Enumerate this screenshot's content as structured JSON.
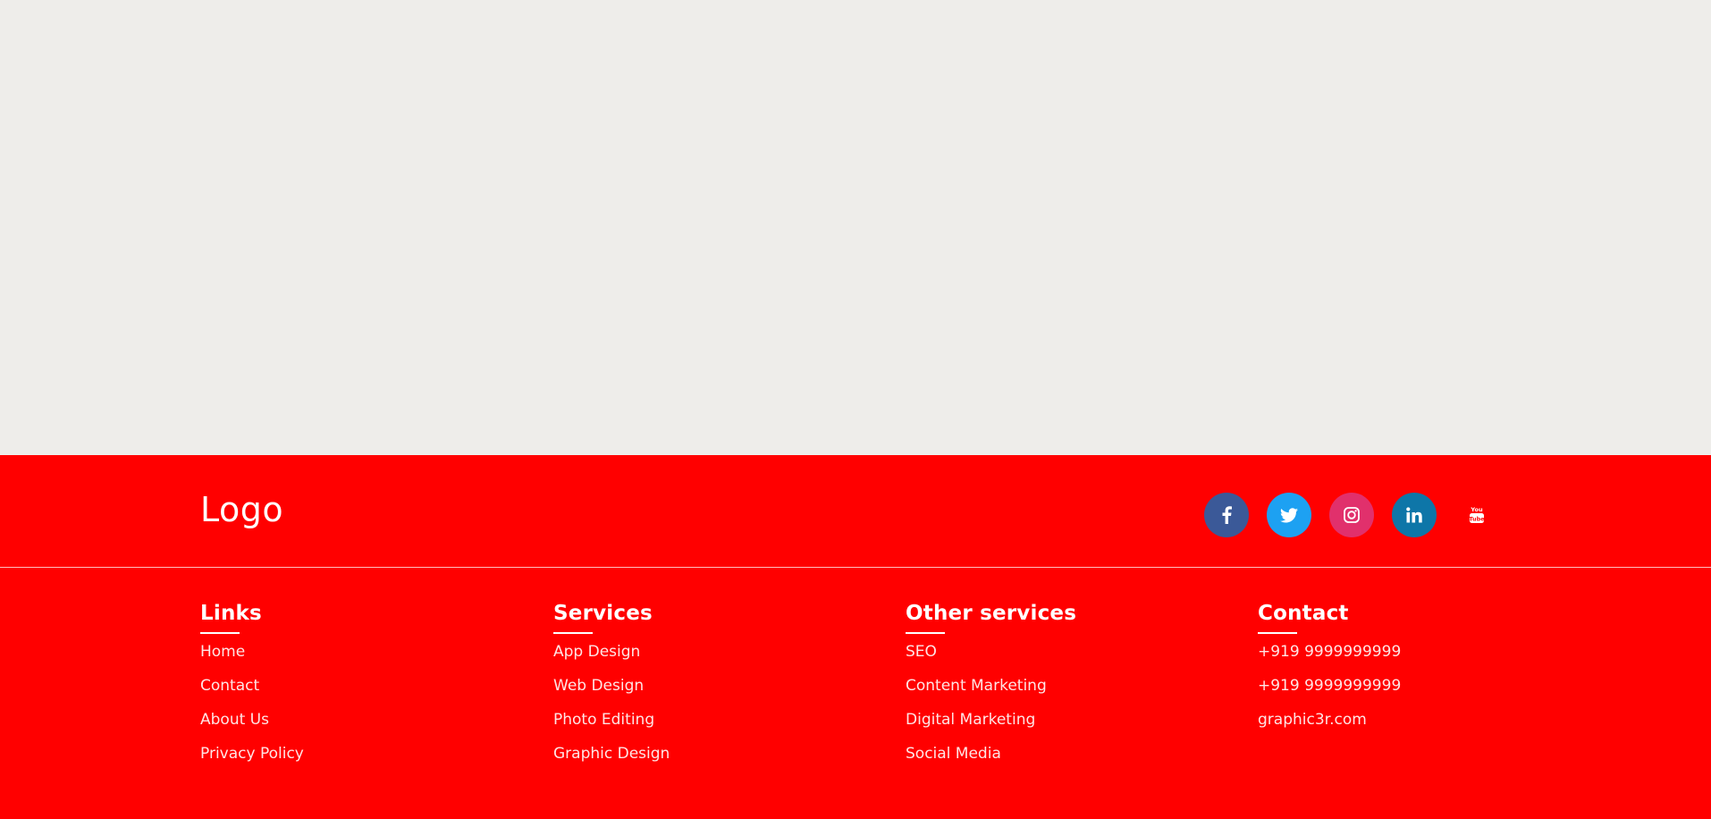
{
  "footer": {
    "logo": "Logo",
    "social": [
      {
        "name": "facebook-icon",
        "color": "#3b5998"
      },
      {
        "name": "twitter-icon",
        "color": "#1da1f2"
      },
      {
        "name": "instagram-icon",
        "color": "#e1306c"
      },
      {
        "name": "linkedin-icon",
        "color": "#0e76a8"
      },
      {
        "name": "youtube-icon",
        "color": "#ff0000"
      }
    ],
    "columns": [
      {
        "title": "Links",
        "items": [
          "Home",
          "Contact",
          "About Us",
          "Privacy Policy"
        ]
      },
      {
        "title": "Services",
        "items": [
          "App Design",
          "Web Design",
          "Photo Editing",
          "Graphic Design"
        ]
      },
      {
        "title": "Other services",
        "items": [
          "SEO",
          "Content Marketing",
          "Digital Marketing",
          "Social Media"
        ]
      },
      {
        "title": "Contact",
        "items": [
          "+919 9999999999",
          "+919 9999999999",
          "graphic3r.com"
        ]
      }
    ],
    "colors": {
      "background": "#ff0000",
      "text": "#ffffff",
      "page_background": "#eeedea"
    }
  }
}
